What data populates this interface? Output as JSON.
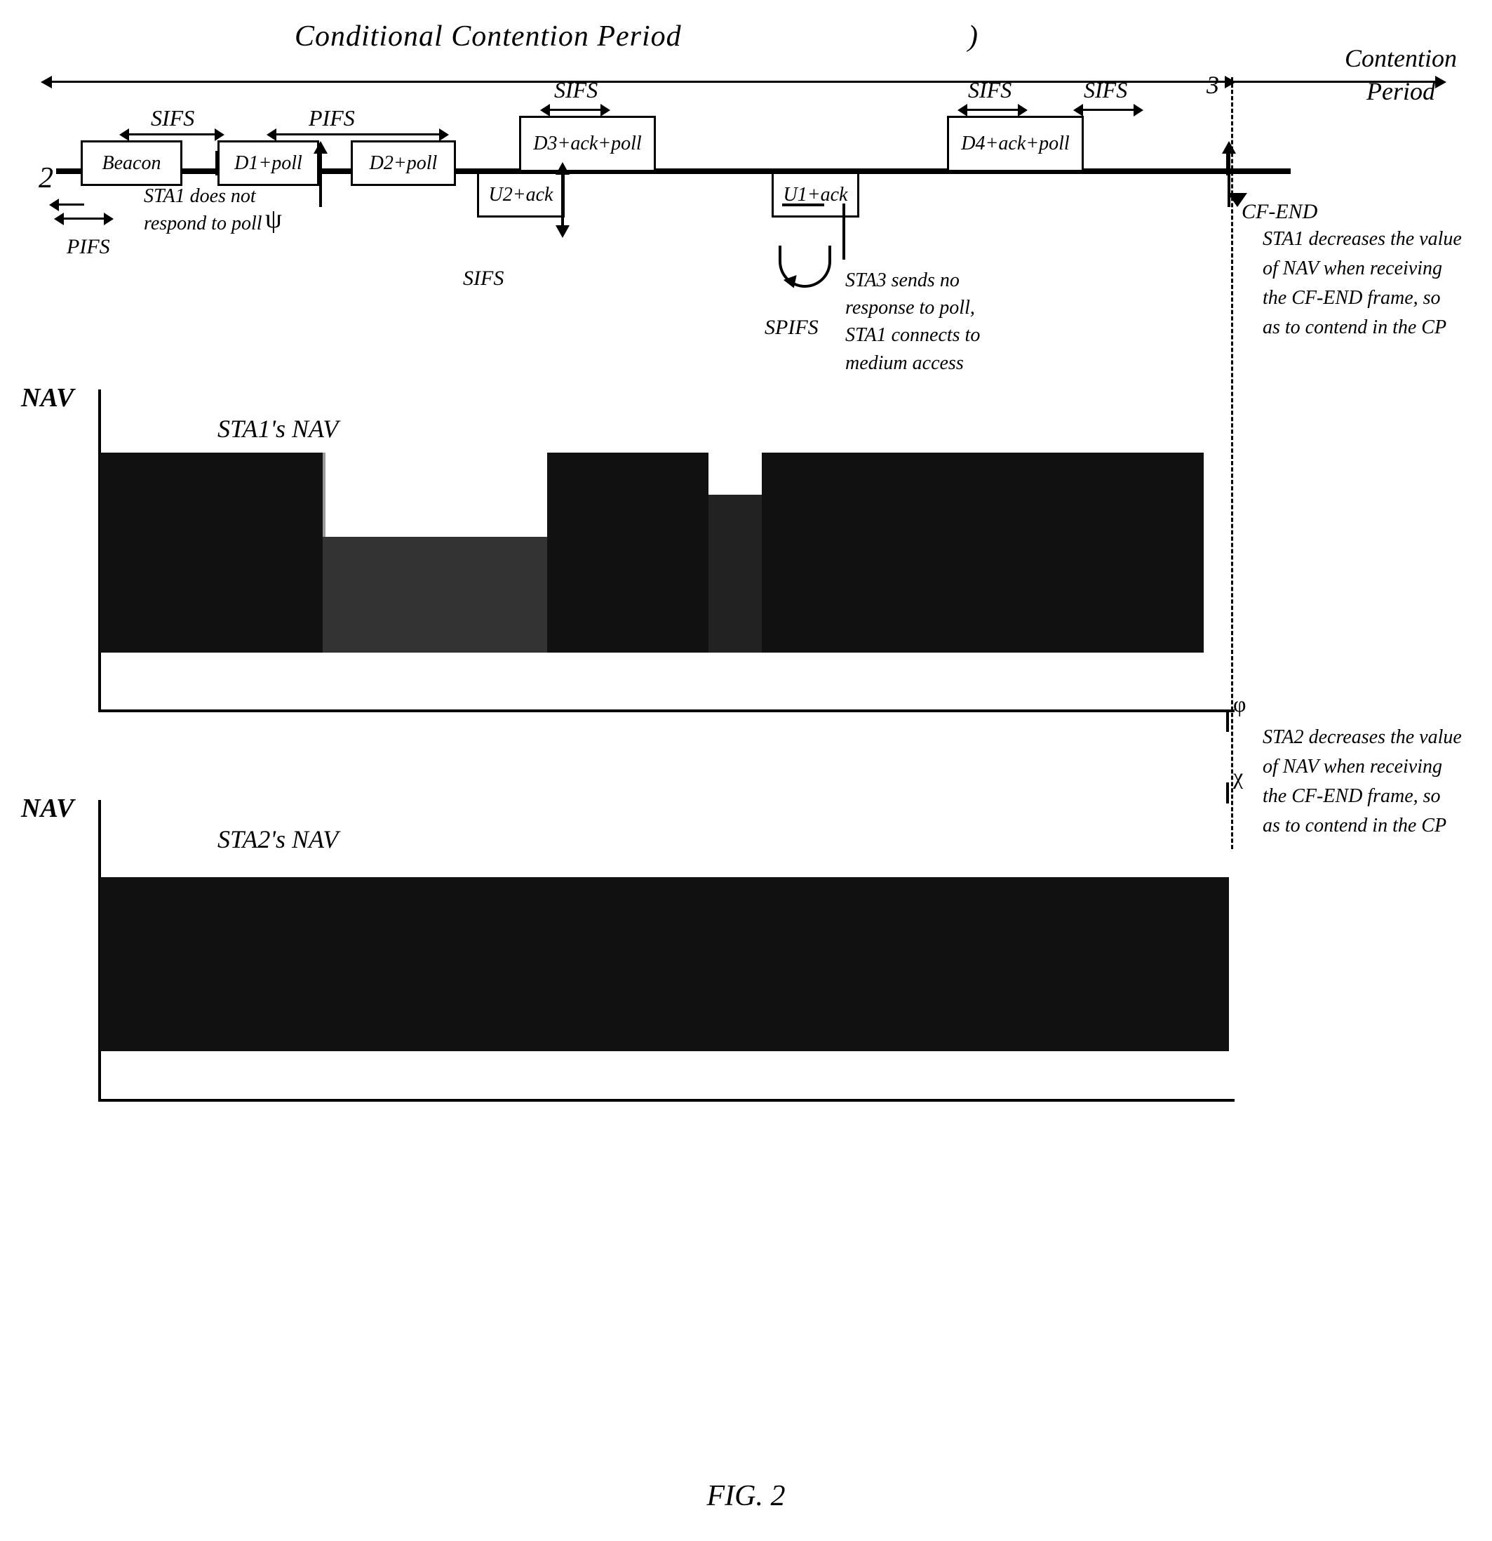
{
  "title": "FIG. 2",
  "diagram": {
    "main_label": "Conditional Contention Period",
    "main_label_paren": ")",
    "contention_period_label": "Contention Period",
    "number_2": "2",
    "number_3": "3",
    "sifs_labels": [
      "SIFS",
      "SIFS",
      "SIFS",
      "SIFS"
    ],
    "pifs_label": "PIFS",
    "pifs_bottom_label": "PIFS",
    "sifs_bottom_label": "SIFS",
    "spifs_label": "SPIFS",
    "boxes": {
      "beacon": "Beacon",
      "d1poll": "D1+poll",
      "d2poll": "D2+poll",
      "d3poll": "D3+ack+poll",
      "d4poll": "D4+ack+poll",
      "u2ack": "U2+ack",
      "u1ack": "U1+ack"
    },
    "cfend_label": "CF-END",
    "sta1_no_respond": "STA1 does not respond to poll",
    "sta3_no_resp": "STA3 sends no response to poll, STA1 connects to medium access",
    "sta1_nav_desc": "STA1 decreases the value of NAV when receiving the CF-END frame, so as to contend in the CP",
    "sta2_nav_desc": "STA2 decreases the value of NAV when receiving the CF-END frame, so as to contend in the CP",
    "nav_label": "NAV",
    "sta1_nav_label": "STA1's NAV",
    "sta2_nav_label": "STA2's NAV",
    "phi_symbol": "φ",
    "psi_symbol": "ψ"
  },
  "fig_label": "FIG. 2"
}
